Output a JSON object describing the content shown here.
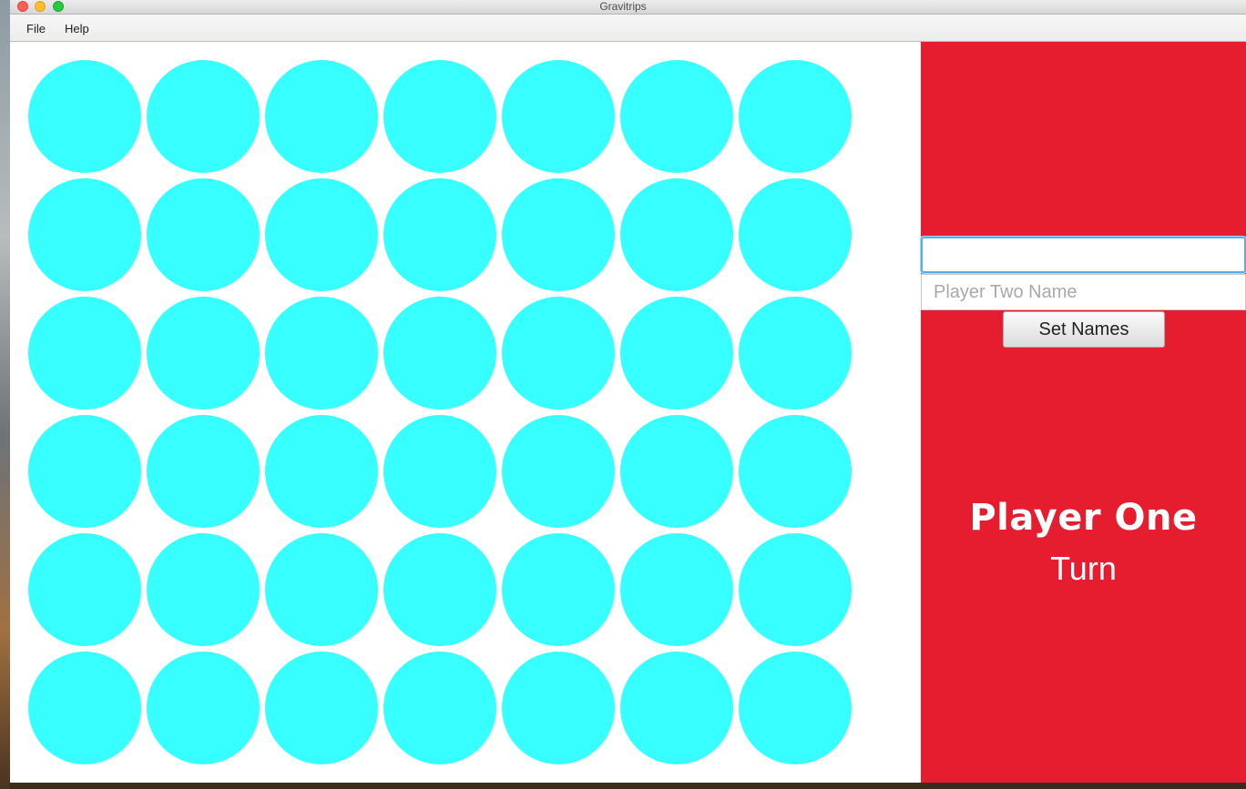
{
  "window": {
    "title": "Gravitrips"
  },
  "menu": {
    "file_label": "File",
    "help_label": "Help"
  },
  "board": {
    "rows": 6,
    "columns": 7,
    "empty_color": "#37ffff"
  },
  "side_panel": {
    "background_color": "#e51d2f",
    "player_one_input": {
      "value": "",
      "placeholder": ""
    },
    "player_two_input": {
      "value": "",
      "placeholder": "Player Two Name"
    },
    "set_names_label": "Set Names",
    "current_player": "Player One",
    "turn_label": "Turn"
  }
}
